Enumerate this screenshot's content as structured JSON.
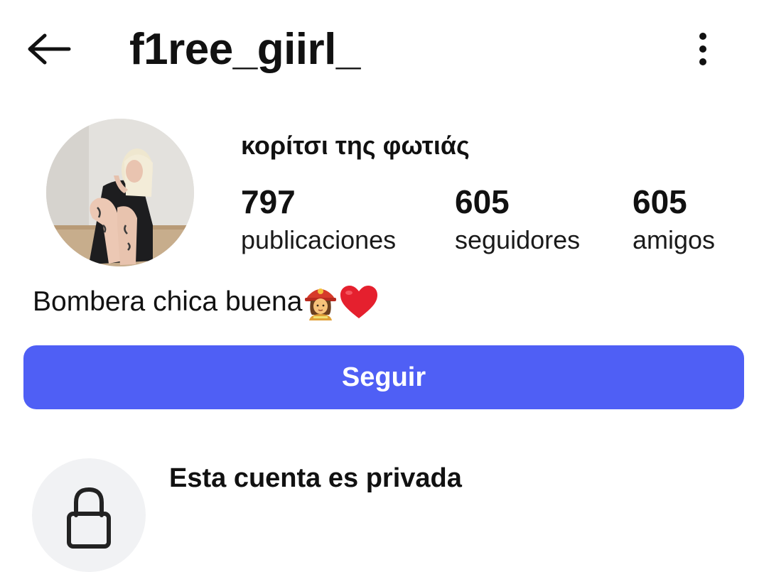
{
  "header": {
    "username": "f1ree_giirl_",
    "back_icon": "arrow-left-icon",
    "menu_icon": "more-vertical-icon"
  },
  "profile": {
    "display_name": "κορίτσι της φωτιάς",
    "stats": [
      {
        "value": "797",
        "label": "publicaciones"
      },
      {
        "value": "605",
        "label": "seguidores"
      },
      {
        "value": "605",
        "label": "amigos"
      }
    ],
    "bio_text": "Bombera chica buena",
    "bio_emojis": [
      "firefighter-woman-icon",
      "red-heart-icon"
    ]
  },
  "follow_button": {
    "label": "Seguir",
    "color": "#4f5ff5"
  },
  "private_notice": {
    "title": "Esta cuenta es privada",
    "icon": "lock-icon"
  }
}
